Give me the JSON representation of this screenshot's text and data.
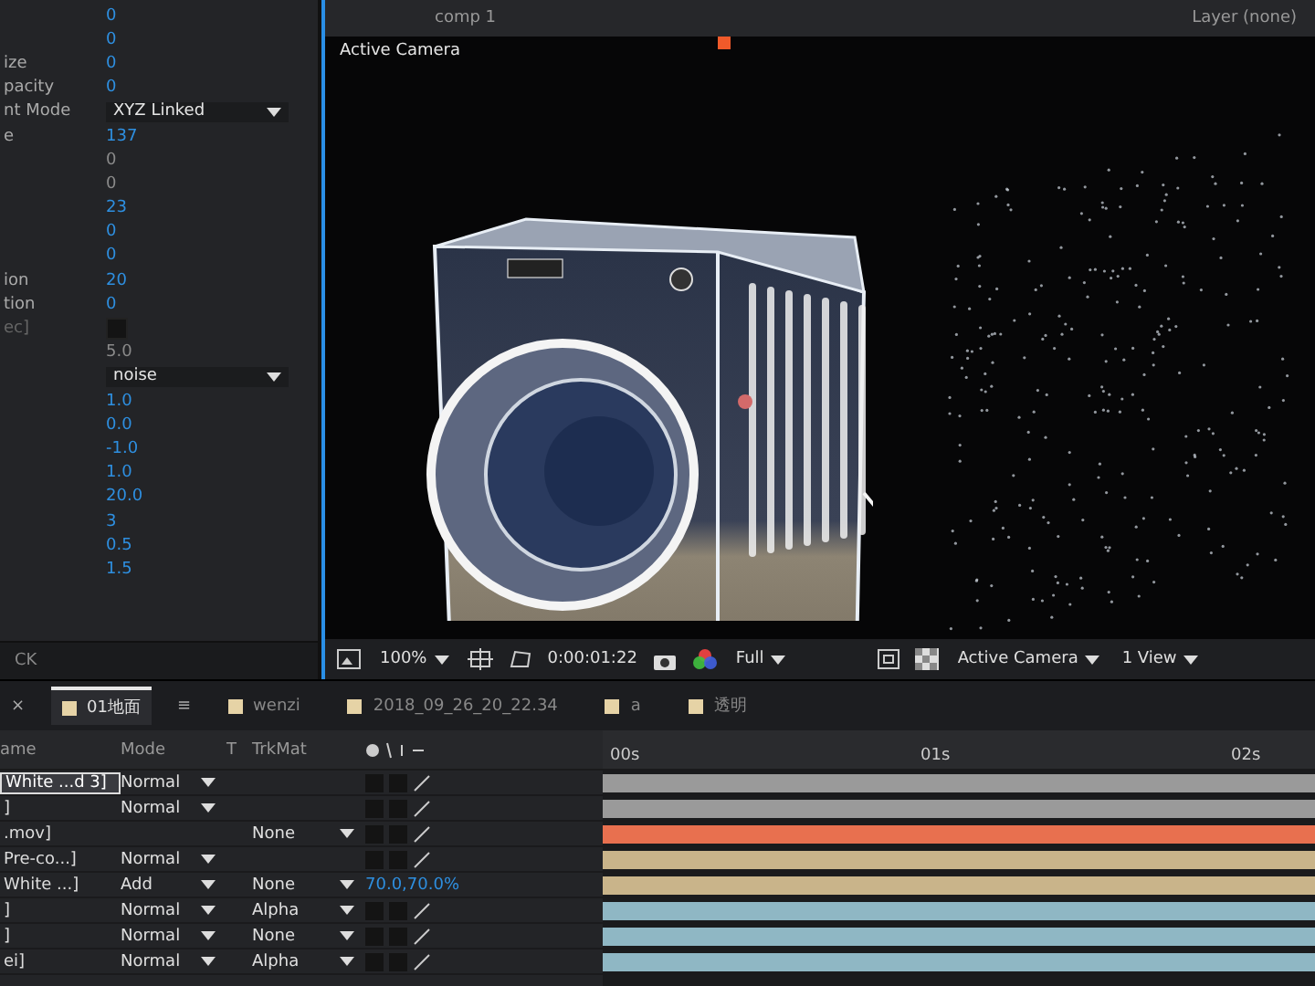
{
  "effect_controls": {
    "rows": [
      {
        "kind": "number",
        "value": "0",
        "disabled": false
      },
      {
        "kind": "number",
        "value": "0",
        "disabled": false
      },
      {
        "kind": "number",
        "label": "ize",
        "value": "0",
        "disabled": false
      },
      {
        "kind": "number",
        "label": "pacity",
        "value": "0",
        "disabled": false
      },
      {
        "kind": "dropdown",
        "label": "nt Mode",
        "value": "XYZ Linked",
        "disabled": false
      },
      {
        "kind": "number",
        "label": "e",
        "value": "137",
        "disabled": false
      },
      {
        "kind": "number",
        "value": "0",
        "disabled": true
      },
      {
        "kind": "number",
        "value": "0",
        "disabled": true
      },
      {
        "kind": "number",
        "value": "23",
        "disabled": false
      },
      {
        "kind": "number",
        "value": "0",
        "disabled": false
      },
      {
        "kind": "number",
        "value": "0",
        "disabled": false
      },
      {
        "kind": "number",
        "label": "ion",
        "value": "20",
        "disabled": false
      },
      {
        "kind": "number",
        "label": "tion",
        "value": "0",
        "disabled": false
      },
      {
        "kind": "swatch",
        "label": "ec]",
        "disabled": true
      },
      {
        "kind": "number",
        "value": "5.0",
        "disabled": true
      },
      {
        "kind": "dropdown",
        "value": "noise",
        "disabled": false
      },
      {
        "kind": "number",
        "value": "1.0",
        "disabled": false
      },
      {
        "kind": "number",
        "value": "0.0",
        "disabled": false
      },
      {
        "kind": "number",
        "value": "-1.0",
        "disabled": false
      },
      {
        "kind": "number",
        "value": "1.0",
        "disabled": false
      },
      {
        "kind": "number",
        "value": "20.0",
        "disabled": false
      },
      {
        "kind": "number",
        "value": "3",
        "disabled": false
      },
      {
        "kind": "number",
        "value": "0.5",
        "disabled": false
      },
      {
        "kind": "number",
        "value": "1.5",
        "disabled": false
      }
    ],
    "footer": "CK"
  },
  "viewer": {
    "comp_tab": "comp 1",
    "layer_tab": "Layer (none)",
    "camera_label": "Active Camera",
    "toolbar": {
      "magnification": "100%",
      "timecode": "0:00:01:22",
      "resolution": "Full",
      "camera": "Active Camera",
      "views": "1 View"
    }
  },
  "comp_tab_bar": {
    "close": "×",
    "menu": "≡",
    "tabs": [
      {
        "label": "01地面",
        "selected": true
      },
      {
        "label": "wenzi",
        "selected": false
      },
      {
        "label": "2018_09_26_20_22.34",
        "selected": false
      },
      {
        "label": "a",
        "selected": false
      },
      {
        "label": "透明",
        "selected": false
      }
    ]
  },
  "timeline": {
    "columns": [
      "ame",
      "Mode",
      "T",
      "TrkMat"
    ],
    "ruler": [
      "00s",
      "01s",
      "02s"
    ],
    "layers": [
      {
        "name": "White ...d 3]",
        "selected": true,
        "mode": "Normal",
        "color": "#9a9a9a"
      },
      {
        "name": "]",
        "selected": false,
        "mode": "Normal",
        "color": "#9a9a9a"
      },
      {
        "name": ".mov]",
        "selected": false,
        "trkmat": "None",
        "color": "#e8704f"
      },
      {
        "name": "Pre-co...]",
        "selected": false,
        "mode": "Normal",
        "color": "#c9b48a"
      },
      {
        "name": "White ...]",
        "selected": false,
        "mode": "Add",
        "trkmat": "None",
        "switch_value": "70.0,70.0%",
        "color": "#c9b48a"
      },
      {
        "name": "]",
        "selected": false,
        "mode": "Normal",
        "trkmat": "Alpha",
        "color": "#8fb7c4"
      },
      {
        "name": "]",
        "selected": false,
        "mode": "Normal",
        "trkmat": "None",
        "color": "#8fb7c4"
      },
      {
        "name": "ei]",
        "selected": false,
        "mode": "Normal",
        "trkmat": "Alpha",
        "color": "#8fb7c4"
      }
    ]
  }
}
